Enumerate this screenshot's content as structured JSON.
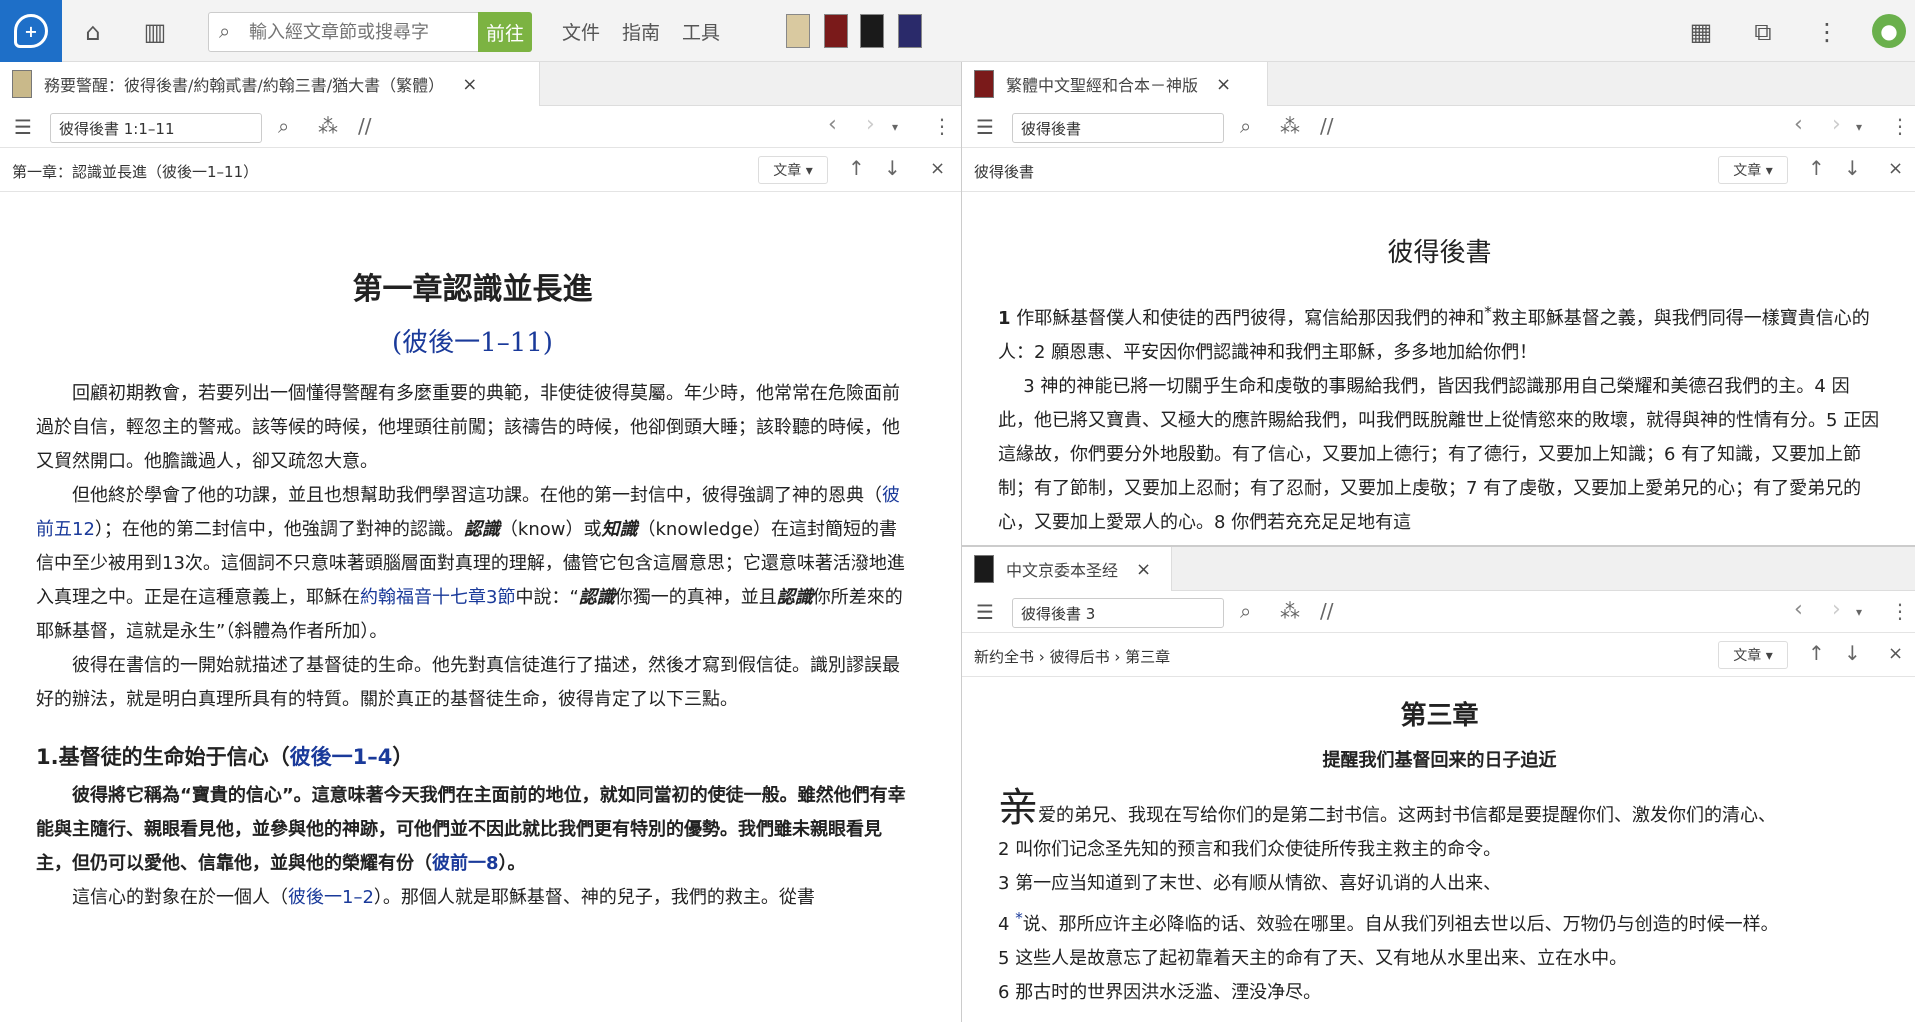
{
  "topbar": {
    "search_placeholder": "輸入經文章節或搜尋字",
    "go_label": "前往",
    "menu": [
      "文件",
      "指南",
      "工具"
    ],
    "book_colors": [
      "#d9c9a0",
      "#7a1a1a",
      "#1a1a1a",
      "#2a2a6a"
    ]
  },
  "left": {
    "tab_title": "務要警醒：彼得後書/約翰貳書/約翰三書/猶大書（繁體）",
    "ref_input": "彼得後書 1:1–11",
    "crumb": "第一章：認識並長進（彼後一1–11）",
    "mode": "文章",
    "heading": "第一章認識並長進",
    "heading_ref": "(彼後一1–11)",
    "p1": "回顧初期教會，若要列出一個懂得警醒有多麼重要的典範，非使徒彼得莫屬。年少時，他常常在危險面前過於自信，輕忽主的警戒。該等候的時候，他埋頭往前闖；該禱告的時候，他卻倒頭大睡；該聆聽的時候，他又貿然開口。他膽識過人，卻又疏忽大意。",
    "p2a": "但他終於學會了他的功課，並且也想幫助我們學習這功課。在他的第一封信中，彼得強調了神的恩典（",
    "p2_link1": "彼前五12",
    "p2b": "）；在他的第二封信中，他強調了對神的認識。",
    "p2_em1": "認識",
    "p2c": "（know）或",
    "p2_em2": "知識",
    "p2d": "（knowledge）在這封簡短的書信中至少被用到13次。這個詞不只意味著頭腦層面對真理的理解，儘管它包含這層意思；它還意味著活潑地進入真理之中。正是在這種意義上，耶穌在",
    "p2_link2": "約翰福音十七章3節",
    "p2e": "中說：“",
    "p2_em3": "認識",
    "p2f": "你獨一的真神，並且",
    "p2_em4": "認識",
    "p2g": "你所差來的耶穌基督，這就是永生”（斜體為作者所加）。",
    "p3": "彼得在書信的一開始就描述了基督徒的生命。他先對真信徒進行了描述，然後才寫到假信徒。識別謬誤最好的辦法，就是明白真理所具有的特質。關於真正的基督徒生命，彼得肯定了以下三點。",
    "h2_prefix": "1.基督徒的生命始于信心（",
    "h2_link": "彼後一1–4",
    "h2_suffix": "）",
    "p4a": "彼得將它稱為“寶貴的信心”。這意味著今天我們在主面前的地位，就如同當初的使徒一般。雖然他們有幸能與主隨行、親眼看見他，並參與他的神跡，可他們並不因此就比我們更有特別的優勢。我們雖未親眼看見主，但仍可以愛他、信靠他，並與他的榮耀有份（",
    "p4_link": "彼前一8",
    "p4b": "）。",
    "p5a": "這信心的對象在於一個人（",
    "p5_link": "彼後一1–2",
    "p5b": "）。那個人就是耶穌基督、神的兒子，我們的救主。從書"
  },
  "right_top": {
    "tab_title": "繁體中文聖經和合本－神版",
    "ref_input": "彼得後書",
    "crumb": "彼得後書",
    "mode": "文章",
    "title": "彼得後書",
    "v1_num": "1",
    "v1": "作耶穌基督僕人和使徒的西門彼得，寫信給那因我們的神和",
    "v1_mark": "*",
    "v1b": "救主耶穌基督之義，與我們同得一樣寶貴信心的人：",
    "v2_num": "2",
    "v2": "願恩惠、平安因你們認識神和我們主耶穌，多多地加給你們！",
    "v3_num": "3",
    "v3": "神的神能已將一切關乎生命和虔敬的事賜給我們，皆因我們認識那用自己榮耀和美德召我們的主。",
    "v4_num": "4",
    "v4": "因此，他已將又寶貴、又極大的應許賜給我們，叫我們既脫離世上從情慾來的敗壞，就得與神的性情有分。",
    "v5_num": "5",
    "v5": "正因這緣故，你們要分外地殷勤。有了信心，又要加上德行；有了德行，又要加上知識；",
    "v6_num": "6",
    "v6": "有了知識，又要加上節制；有了節制，又要加上忍耐；有了忍耐，又要加上虔敬；",
    "v7_num": "7",
    "v7": "有了虔敬，又要加上愛弟兄的心；有了愛弟兄的心，又要加上愛眾人的心。",
    "v8_num": "8",
    "v8": "你們若充充足足地有這"
  },
  "right_bottom": {
    "tab_title": "中文京委本圣经",
    "ref_input": "彼得後書 3",
    "crumbs": [
      "新约全书",
      "彼得后书",
      "第三章"
    ],
    "mode": "文章",
    "chapter": "第三章",
    "subtitle": "提醒我们基督回来的日子迫近",
    "v1_cap": "亲",
    "v1": "爱的弟兄、我现在写给你们的是第二封书信。这两封书信都是要提醒你们、激发你们的清心、",
    "v2_num": "2",
    "v2": "叫你们记念圣先知的预言和我们众使徒所传我主救主的命令。",
    "v3_num": "3",
    "v3": "第一应当知道到了末世、必有顺从情欲、喜好讥诮的人出来、",
    "v4_num": "4",
    "v4_mark": "*",
    "v4": "说、那所应许主必降临的话、效验在哪里。自从我们列祖去世以后、万物仍与创造的时候一样。",
    "v5_num": "5",
    "v5": "这些人是故意忘了起初靠着天主的命有了天、又有地从水里出来、立在水中。",
    "v6_num": "6",
    "v6": "那古时的世界因洪水泛滥、湮没净尽。"
  }
}
